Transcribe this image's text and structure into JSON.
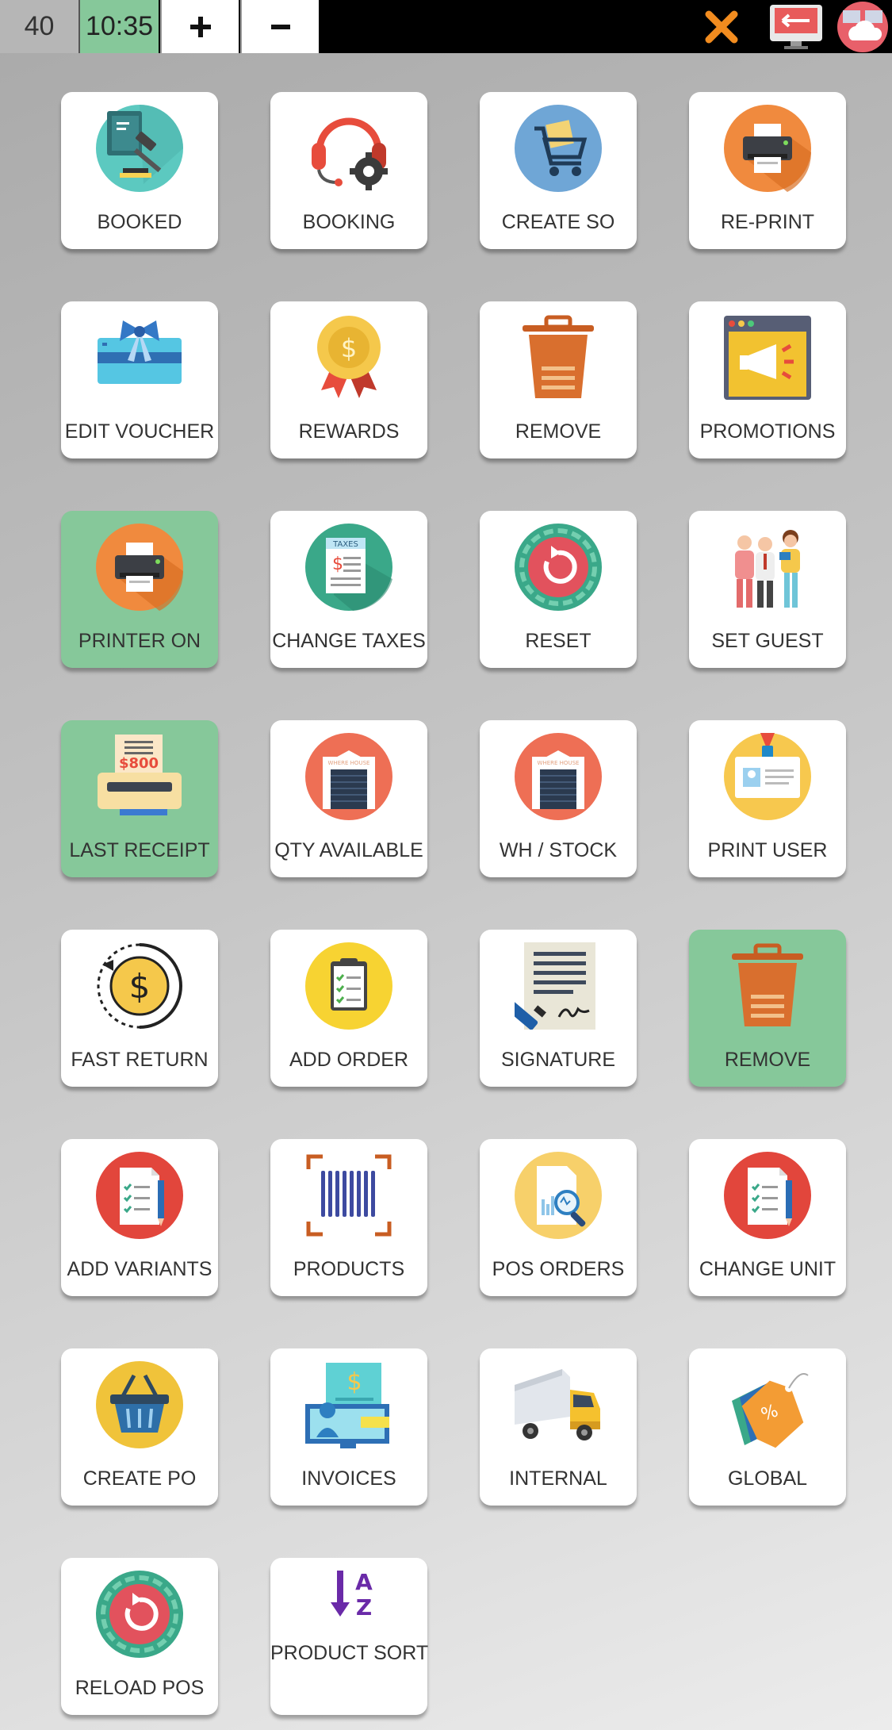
{
  "topbar": {
    "count": "40",
    "time": "10:35",
    "plus_icon": "plus-icon",
    "minus_icon": "minus-icon",
    "close_icon": "close-icon",
    "screen_icon": "exit-screen-icon",
    "cloud_icon": "cloud-sync-icon",
    "close_color": "#f28c1f"
  },
  "tiles": [
    {
      "label": "BOOKED",
      "icon": "booked-icon",
      "active": false
    },
    {
      "label": "BOOKING",
      "icon": "headset-icon",
      "active": false
    },
    {
      "label": "CREATE SO",
      "icon": "cart-icon",
      "active": false
    },
    {
      "label": "RE-PRINT",
      "icon": "printer-icon",
      "active": false
    },
    {
      "label": "EDIT VOUCHER",
      "icon": "gift-card-icon",
      "active": false
    },
    {
      "label": "REWARDS",
      "icon": "reward-medal-icon",
      "active": false
    },
    {
      "label": "REMOVE",
      "icon": "trash-icon",
      "active": false
    },
    {
      "label": "PROMOTIONS",
      "icon": "megaphone-icon",
      "active": false
    },
    {
      "label": "PRINTER ON",
      "icon": "printer-icon",
      "active": true
    },
    {
      "label": "CHANGE TAXES",
      "icon": "taxes-icon",
      "active": false
    },
    {
      "label": "RESET",
      "icon": "reset-icon",
      "active": false
    },
    {
      "label": "SET GUEST",
      "icon": "guests-icon",
      "active": false
    },
    {
      "label": "LAST RECEIPT",
      "icon": "receipt-icon",
      "active": true
    },
    {
      "label": "QTY AVAILABLE",
      "icon": "warehouse-icon",
      "active": false
    },
    {
      "label": "WH / STOCK",
      "icon": "warehouse-icon",
      "active": false
    },
    {
      "label": "PRINT USER",
      "icon": "id-badge-icon",
      "active": false
    },
    {
      "label": "FAST RETURN",
      "icon": "dollar-return-icon",
      "active": false
    },
    {
      "label": "ADD ORDER",
      "icon": "clipboard-icon",
      "active": false
    },
    {
      "label": "SIGNATURE",
      "icon": "signature-icon",
      "active": false
    },
    {
      "label": "REMOVE",
      "icon": "trash-icon",
      "active": true
    },
    {
      "label": "ADD VARIANTS",
      "icon": "checklist-icon",
      "active": false
    },
    {
      "label": "PRODUCTS",
      "icon": "barcode-icon",
      "active": false
    },
    {
      "label": "POS ORDERS",
      "icon": "report-search-icon",
      "active": false
    },
    {
      "label": "CHANGE UNIT",
      "icon": "checklist-icon",
      "active": false
    },
    {
      "label": "CREATE PO",
      "icon": "basket-icon",
      "active": false
    },
    {
      "label": "INVOICES",
      "icon": "invoice-icon",
      "active": false
    },
    {
      "label": "INTERNAL",
      "icon": "truck-icon",
      "active": false
    },
    {
      "label": "GLOBAL",
      "icon": "price-tag-icon",
      "active": false
    },
    {
      "label": "RELOAD POS",
      "icon": "reset-icon",
      "active": false
    },
    {
      "label": "PRODUCT SORT",
      "icon": "sort-az-icon",
      "active": false
    }
  ]
}
